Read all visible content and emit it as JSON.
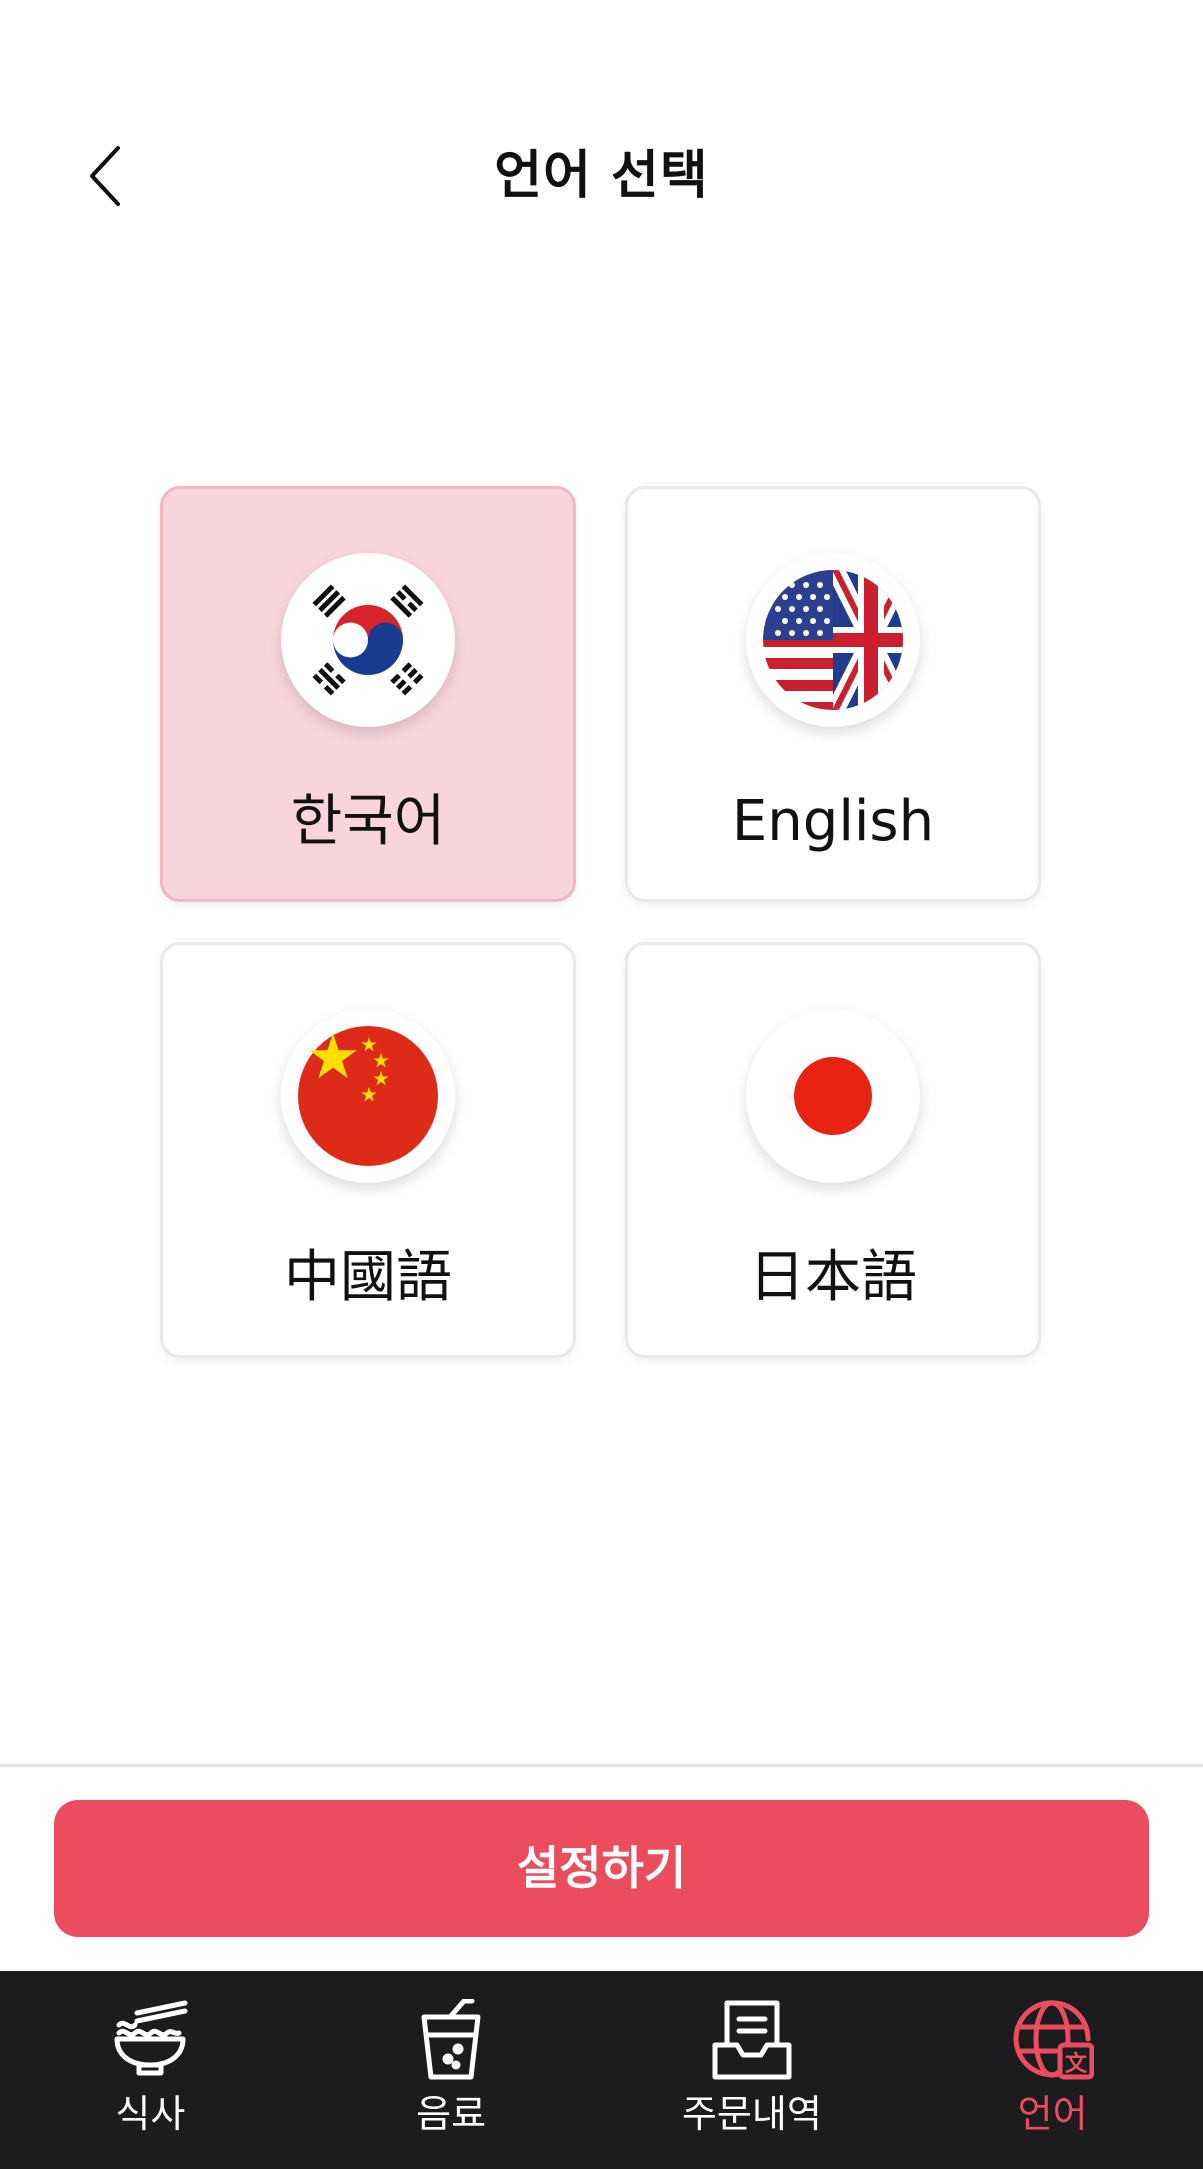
{
  "header": {
    "title": "언어 선택"
  },
  "languages": [
    {
      "label": "한국어",
      "flag": "korea-flag-icon",
      "selected": true
    },
    {
      "label": "English",
      "flag": "us-uk-flag-icon",
      "selected": false
    },
    {
      "label": "中國語",
      "flag": "china-flag-icon",
      "selected": false
    },
    {
      "label": "日本語",
      "flag": "japan-flag-icon",
      "selected": false
    }
  ],
  "confirm_button": {
    "label": "설정하기"
  },
  "bottom_nav": {
    "items": [
      {
        "label": "식사",
        "icon": "noodle-bowl-icon",
        "active": false
      },
      {
        "label": "음료",
        "icon": "drink-cup-icon",
        "active": false
      },
      {
        "label": "주문내역",
        "icon": "inbox-tray-icon",
        "active": false
      },
      {
        "label": "언어",
        "icon": "globe-language-icon",
        "active": true
      }
    ]
  },
  "colors": {
    "accent": "#eb4d5e",
    "selected_card_bg": "#f8d5dc",
    "nav_bg": "#1c1c1e"
  }
}
